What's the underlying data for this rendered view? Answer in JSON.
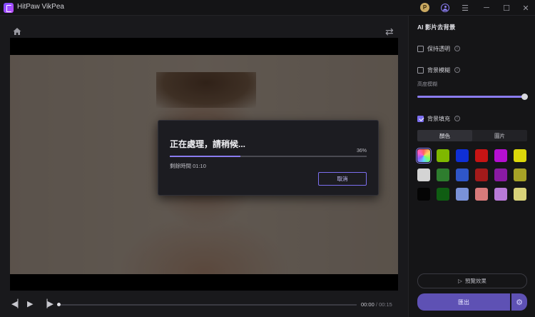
{
  "titlebar": {
    "app_title": "HitPaw VikPea",
    "avatar_letter": "P",
    "menu_glyph": "☰",
    "min_glyph": "─",
    "max_glyph": "☐",
    "close_glyph": "✕"
  },
  "dialog": {
    "title": "正在處理，請稍候...",
    "percent_label": "36%",
    "progress_fraction": 0.36,
    "remaining_label": "剩餘時間",
    "remaining_time": "01:10",
    "cancel_label": "取消"
  },
  "player": {
    "prev_glyph": "◀▏",
    "play_glyph": "▶",
    "next_glyph": "▕▶",
    "current_time": "00:00",
    "separator": "/",
    "total_time": "00:15",
    "seek_fraction": 0.0
  },
  "panel": {
    "title": "AI 影片去背景",
    "keep_transparent": "保持透明",
    "bg_blur": "背景模糊",
    "blur_level_label": "高度模糊",
    "blur_level_fraction": 1.0,
    "bg_fill": "背景填充",
    "info_glyph": "i",
    "tabs": [
      "顏色",
      "圖片"
    ],
    "preview_label": "預覽效果",
    "export_label": "匯出",
    "gear_glyph": "⚙",
    "colors": [
      [
        "gradient",
        "#7fb800",
        "#0f2fd6",
        "#c81414",
        "#b50fd2",
        "#dcd80a"
      ],
      [
        "#d4d4d4",
        "#2e7d2e",
        "#2f56c8",
        "#a31a1a",
        "#8a1aa3",
        "#a6a226"
      ],
      [
        "#050505",
        "#0f5d12",
        "#7a92d8",
        "#d87a7a",
        "#b97ad8",
        "#d8d27a"
      ]
    ]
  },
  "accent": "#8a7cf0"
}
